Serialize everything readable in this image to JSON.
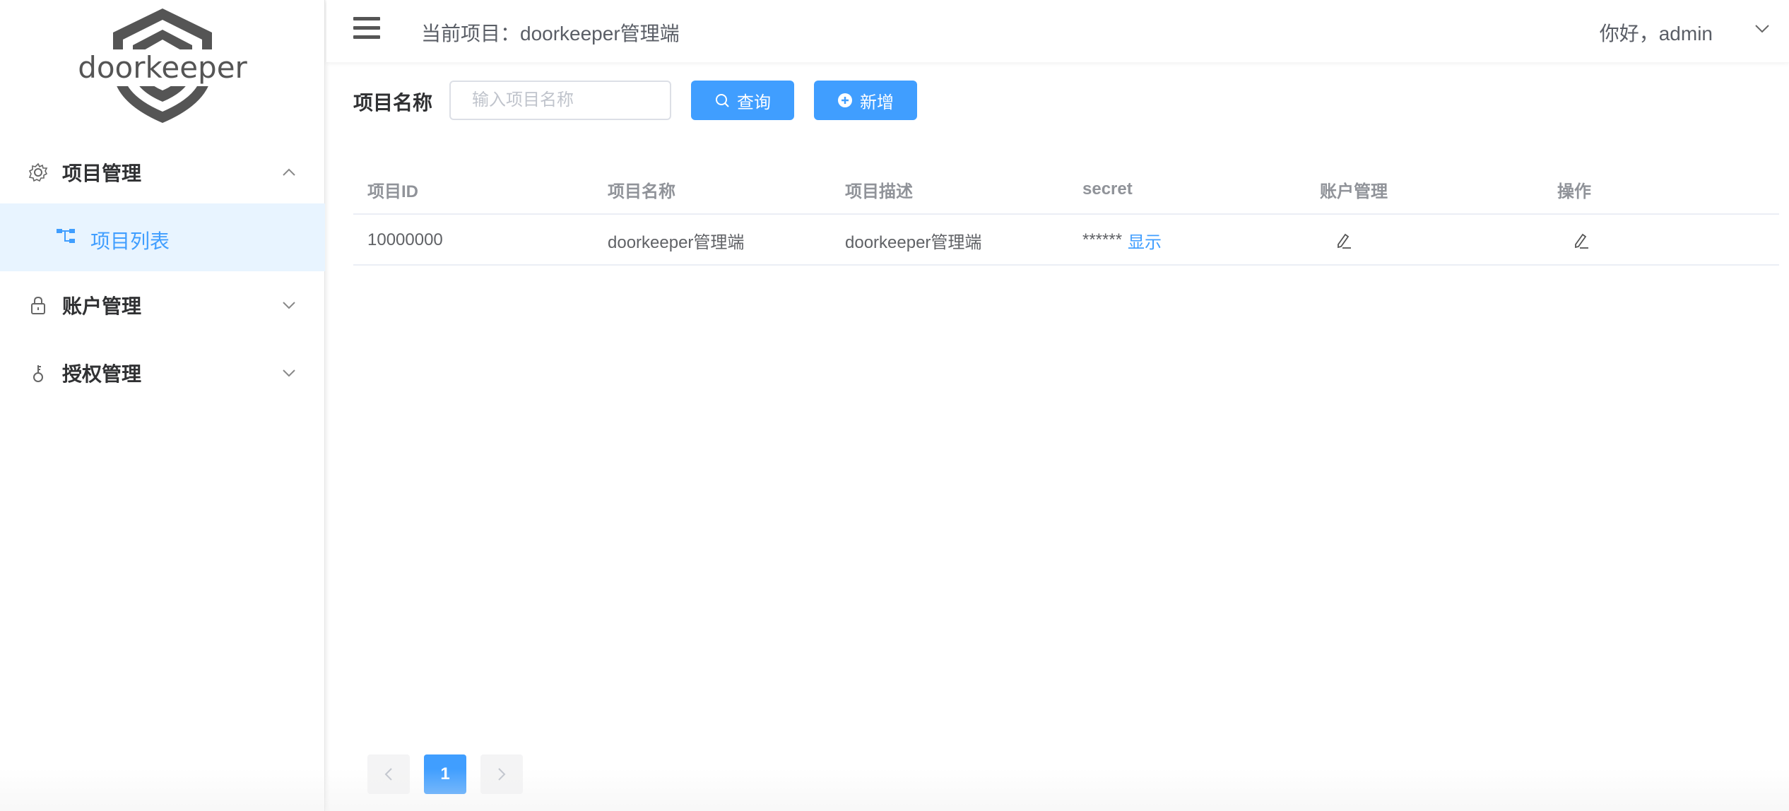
{
  "brand": {
    "logo_text": "doorkeeper"
  },
  "sidebar": {
    "items": [
      {
        "label": "项目管理",
        "icon": "gear-icon",
        "expanded": true
      },
      {
        "label": "项目列表",
        "icon": "tree-icon",
        "active": true
      },
      {
        "label": "账户管理",
        "icon": "lock-icon",
        "expanded": false
      },
      {
        "label": "授权管理",
        "icon": "key-icon",
        "expanded": false
      }
    ]
  },
  "header": {
    "current_project": "当前项目：doorkeeper管理端",
    "greeting": "你好，admin"
  },
  "search": {
    "label": "项目名称",
    "placeholder": "输入项目名称",
    "value": "",
    "query_button": "查询",
    "add_button": "新增"
  },
  "table": {
    "columns": [
      "项目ID",
      "项目名称",
      "项目描述",
      "secret",
      "账户管理",
      "操作"
    ],
    "rows": [
      {
        "id": "10000000",
        "name": "doorkeeper管理端",
        "description": "doorkeeper管理端",
        "secret_masked": "******",
        "secret_show": "显示"
      }
    ]
  },
  "pagination": {
    "current_page": "1"
  },
  "colors": {
    "primary": "#409eff",
    "active_bg": "#e8f4ff",
    "text": "#303133",
    "muted": "#909399"
  }
}
